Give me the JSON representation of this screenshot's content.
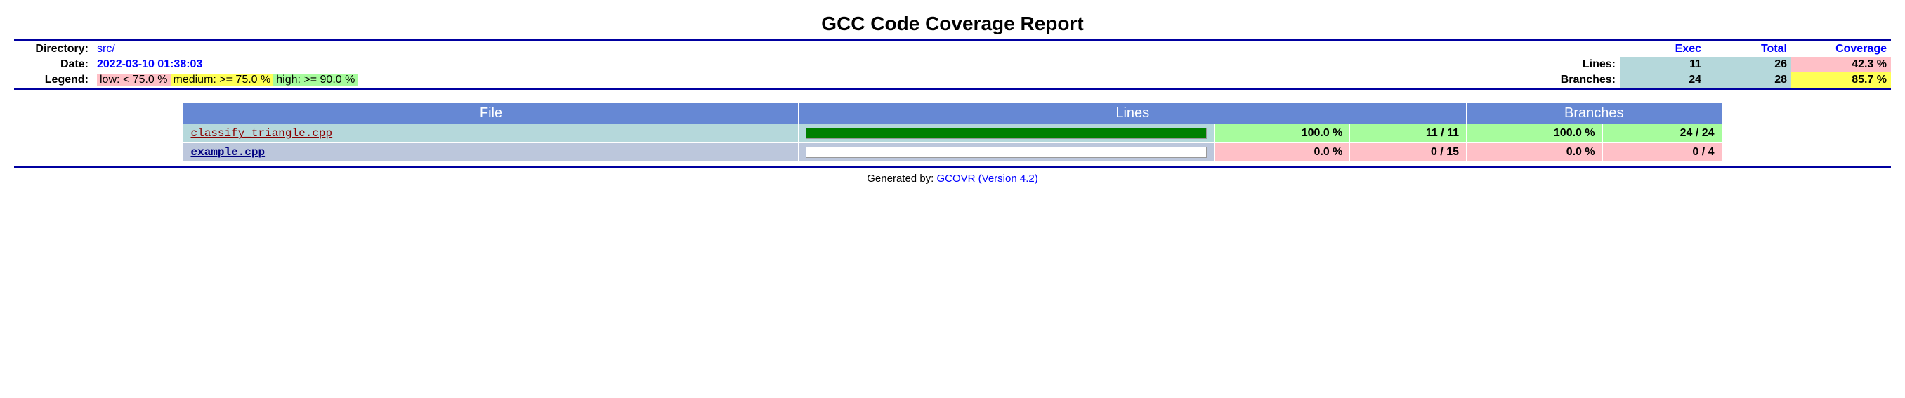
{
  "title": "GCC Code Coverage Report",
  "header": {
    "directory_label": "Directory:",
    "directory_value": "src/",
    "date_label": "Date:",
    "date_value": "2022-03-10 01:38:03",
    "legend_label": "Legend:",
    "legend_low": "low: < 75.0 %",
    "legend_med": "medium: >= 75.0 %",
    "legend_high": "high: >= 90.0 %",
    "col_exec": "Exec",
    "col_total": "Total",
    "col_coverage": "Coverage",
    "row_lines": "Lines:",
    "row_branches": "Branches:",
    "lines": {
      "exec": "11",
      "total": "26",
      "coverage": "42.3 %"
    },
    "branches": {
      "exec": "24",
      "total": "28",
      "coverage": "85.7 %"
    }
  },
  "files": {
    "heads": {
      "file": "File",
      "lines": "Lines",
      "branches": "Branches"
    },
    "rows": [
      {
        "name": "classify_triangle.cpp",
        "link_class": "file-link-a",
        "row_class": "row-light",
        "line_pct": "100.0 %",
        "line_ct": "11 / 11",
        "br_pct": "100.0 %",
        "br_ct": "24 / 24",
        "line_bg": "bg-green",
        "br_bg": "bg-green",
        "bar_pct": 100
      },
      {
        "name": "example.cpp",
        "link_class": "file-link-b",
        "row_class": "row-dark",
        "line_pct": "0.0 %",
        "line_ct": "0 / 15",
        "br_pct": "0.0 %",
        "br_ct": "0 / 4",
        "line_bg": "bg-pink",
        "br_bg": "bg-pink",
        "bar_pct": 0
      }
    ]
  },
  "footer": {
    "prefix": "Generated by: ",
    "link": "GCOVR (Version 4.2)"
  }
}
